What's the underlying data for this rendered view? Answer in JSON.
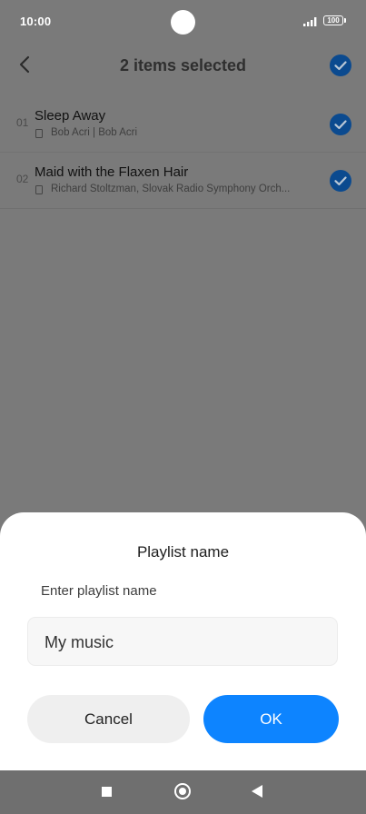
{
  "status_bar": {
    "time": "10:00",
    "battery": "100"
  },
  "header": {
    "title": "2 items selected"
  },
  "tracks": [
    {
      "number": "01",
      "title": "Sleep Away",
      "subtitle": "Bob Acri | Bob Acri",
      "selected": true
    },
    {
      "number": "02",
      "title": "Maid with the Flaxen Hair",
      "subtitle": "Richard Stoltzman, Slovak Radio Symphony Orch...",
      "selected": true
    }
  ],
  "dialog": {
    "title": "Playlist name",
    "hint": "Enter playlist name",
    "input_value": "My music",
    "cancel_label": "Cancel",
    "ok_label": "OK"
  },
  "colors": {
    "accent": "#0d84ff",
    "check_dark": "#0b4a8f",
    "scrim": "#7a7a7a"
  }
}
